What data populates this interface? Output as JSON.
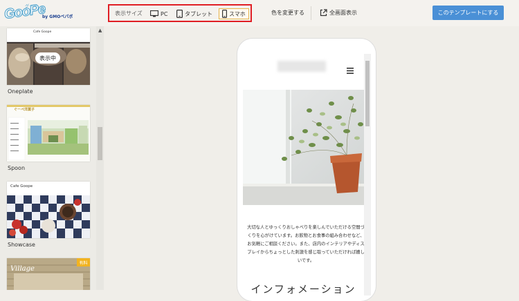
{
  "header": {
    "logo_text": "GooPe",
    "logo_kana": "グーペ",
    "logo_gmo": "by GMOペパボ",
    "size_label": "表示サイズ",
    "devices": [
      {
        "label": "PC",
        "icon": "monitor-icon",
        "selected": false
      },
      {
        "label": "タブレット",
        "icon": "tablet-icon",
        "selected": false
      },
      {
        "label": "スマホ",
        "icon": "smartphone-icon",
        "selected": true
      }
    ],
    "color_link": "色を変更する",
    "fullscreen_link": "全画面表示",
    "use_button": "このテンプレートにする",
    "accent_color": "#4a90d6",
    "highlight_color": "#e01e24"
  },
  "sidebar": {
    "templates": [
      {
        "name": "Oneplate",
        "site_title": "Cafe Goope",
        "badge": "表示中"
      },
      {
        "name": "Spoon",
        "site_title": "ぐーぺ洋菓子"
      },
      {
        "name": "Showcase",
        "site_title": "Cafe Goope"
      },
      {
        "name": "",
        "site_title": "Village",
        "badge": "有料"
      }
    ]
  },
  "preview": {
    "intro_text": "大切な人とゆっくりおしゃべりを楽しんでいただける空間づくりを心がけています。お飲物とお食事の組み合わせなど、お気軽にご相談ください。また、店内のインテリアやディスプレイからちょっとした刺激を感じ取っていただければ嬉しいです。",
    "section_title": "インフォメーション"
  }
}
